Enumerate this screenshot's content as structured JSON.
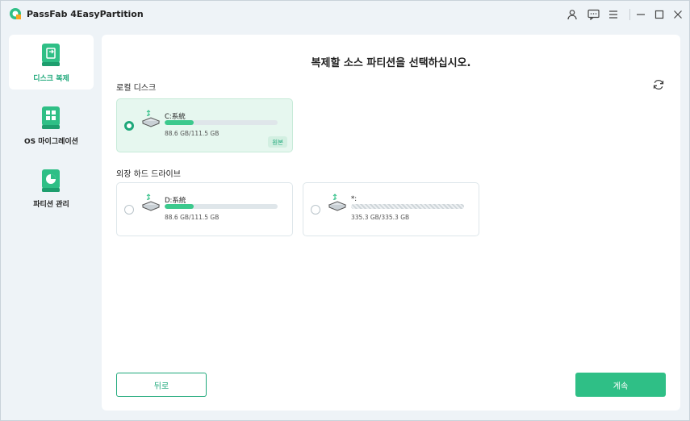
{
  "app": {
    "title": "PassFab 4EasyPartition"
  },
  "sidebar": {
    "items": [
      {
        "label": "디스크 복제",
        "active": true
      },
      {
        "label": "OS 마이그레이션",
        "active": false
      },
      {
        "label": "파티션 관리",
        "active": false
      }
    ]
  },
  "main": {
    "heading": "복제할 소스 파티션을 선택하십시오.",
    "local_section": "로컬 디스크",
    "external_section": "외장 하드 드라이브",
    "local_disks": [
      {
        "name": "C:系統",
        "size": "88.6 GB/111.5 GB",
        "usage": 0.26,
        "selected": true,
        "badge": "원본"
      }
    ],
    "external_disks": [
      {
        "name": "D:系統",
        "size": "88.6 GB/111.5 GB",
        "usage": 0.26,
        "selected": false
      },
      {
        "name": "*:",
        "size": "335.3 GB/335.3 GB",
        "usage": 1.0,
        "selected": false
      }
    ]
  },
  "buttons": {
    "back": "뒤로",
    "next": "계속"
  },
  "colors": {
    "accent": "#1ea87a",
    "primary_button": "#2fbf86",
    "selected_card": "#e6f7ef"
  }
}
